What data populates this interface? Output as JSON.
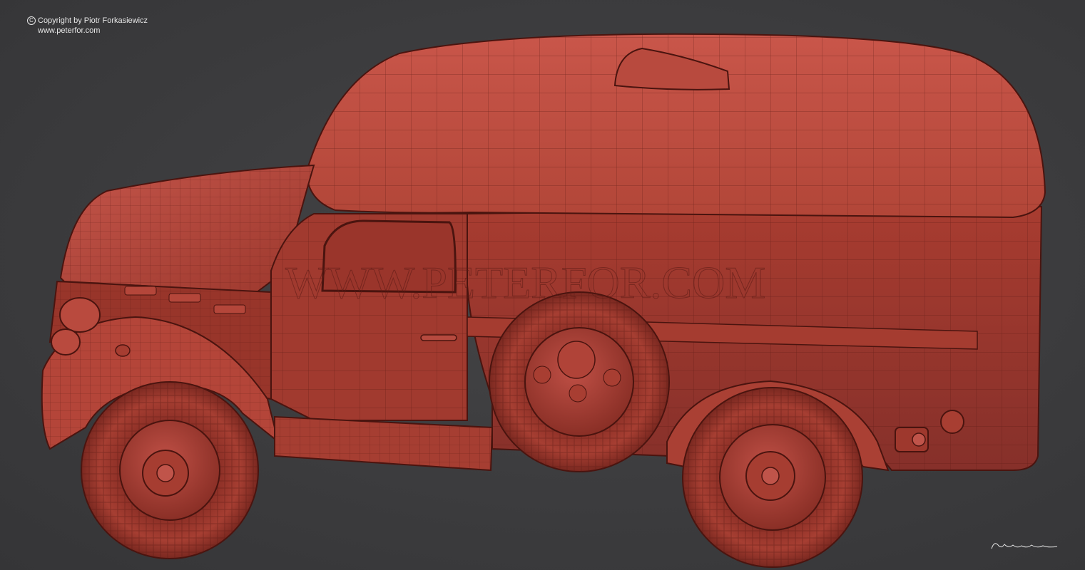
{
  "watermark": {
    "copyright": "Copyright by Piotr Forkasiewicz",
    "website": "www.peterfor.com",
    "overlay_text": "WWW.PETERFOR.COM"
  },
  "colors": {
    "background": "#3d3d3f",
    "body_red": "#b8493c",
    "body_dark": "#7a2a22",
    "wire": "#5a1a14",
    "text": "#e8e8e8"
  },
  "icons": {
    "copyright": "copyright-icon",
    "signature": "signature"
  }
}
